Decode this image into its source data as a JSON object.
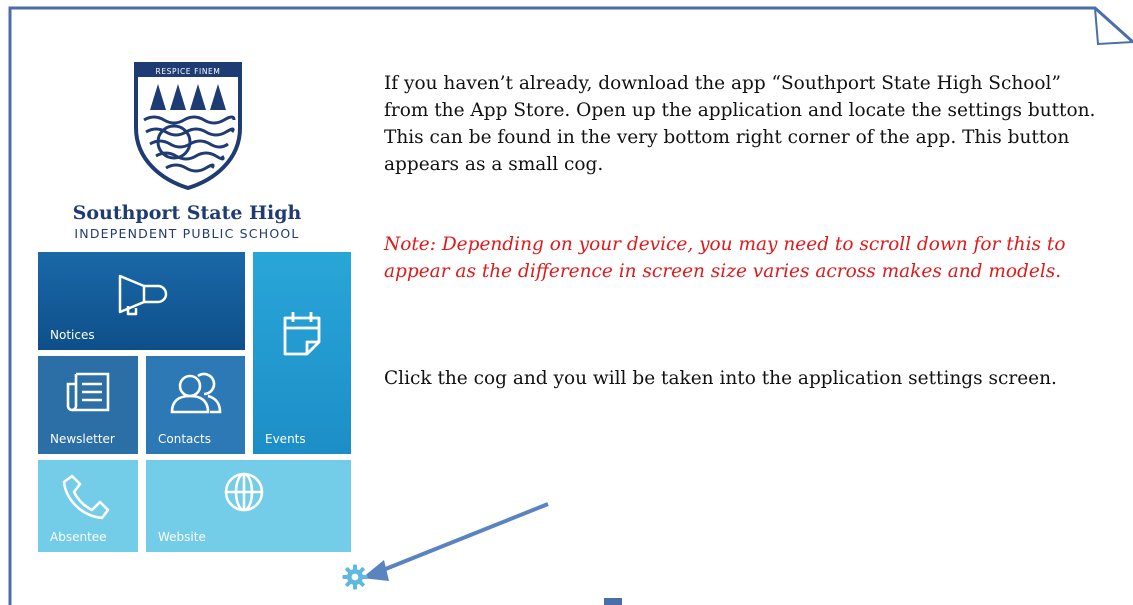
{
  "app": {
    "crest_motto": "RESPICE FINEM",
    "school_name": "Southport State High",
    "school_subtitle": "INDEPENDENT PUBLIC SCHOOL"
  },
  "tiles": {
    "notices": "Notices",
    "events": "Events",
    "newsletter": "Newsletter",
    "contacts": "Contacts",
    "absentee": "Absentee",
    "website": "Website"
  },
  "instructions": {
    "paragraph1": "If you haven’t already, download the app “Southport State High School” from the App Store. Open up the application and locate the settings button. This can be found in the very bottom right corner of the app. This button appears as a small cog.",
    "note": "Note: Depending on your device, you may need to scroll down for this to appear as the difference in screen size varies across makes and models.",
    "paragraph2": "Click the cog and you will be taken into the application settings screen."
  },
  "colors": {
    "frame_border": "#4a6ea8",
    "arrow": "#5a84bf",
    "note_text": "#e0191b",
    "school_navy": "#1f3b73",
    "tile_dark": "#0e4f8a",
    "tile_mid": "#2b6fa6",
    "tile_light": "#73cde9",
    "cog": "#5fb8e0"
  },
  "icons": {
    "notices": "megaphone-icon",
    "events": "calendar-icon",
    "newsletter": "newspaper-icon",
    "contacts": "people-icon",
    "absentee": "phone-icon",
    "website": "globe-icon",
    "settings": "gear-icon"
  }
}
